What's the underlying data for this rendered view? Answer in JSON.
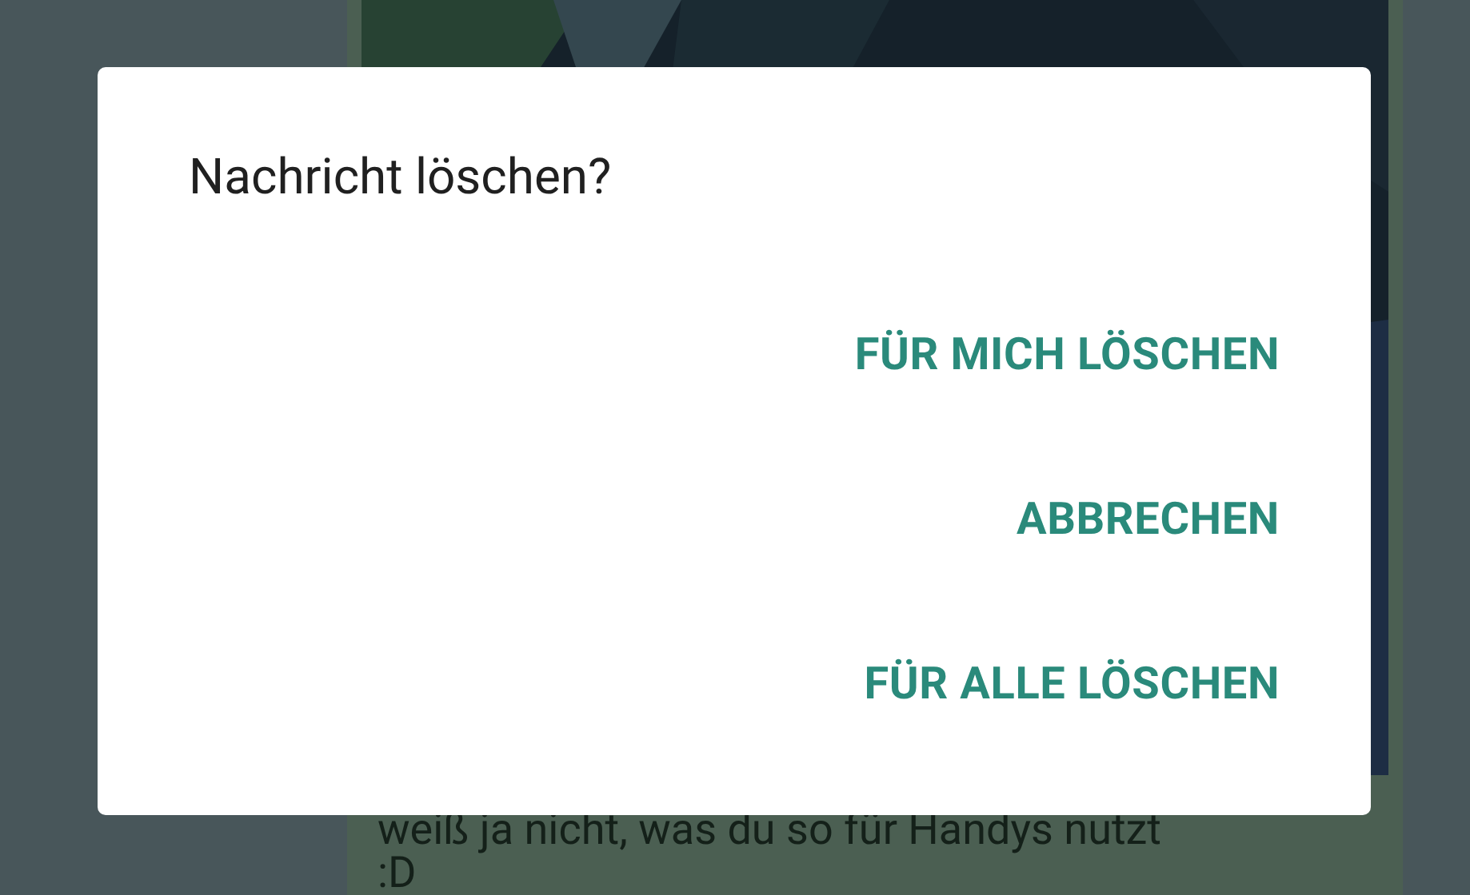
{
  "chat": {
    "message": {
      "text": "weiß ja nicht, was du so für Handys nutzt :D"
    }
  },
  "dialog": {
    "title": "Nachricht löschen?",
    "buttons": [
      {
        "label": "FÜR MICH LÖSCHEN"
      },
      {
        "label": "ABBRECHEN"
      },
      {
        "label": "FÜR ALLE LÖSCHEN"
      }
    ]
  }
}
